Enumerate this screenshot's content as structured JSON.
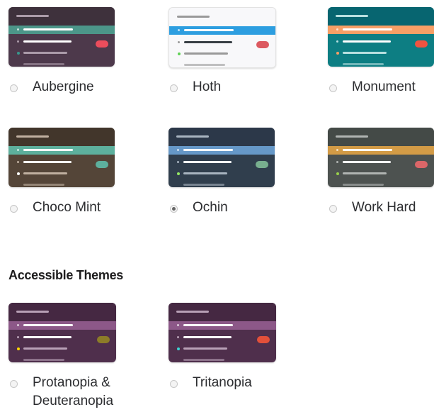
{
  "themes": [
    {
      "id": "aubergine",
      "label": "Aubergine",
      "selected": false,
      "colors": {
        "bg": "#4d394b",
        "top": "#3e313c",
        "active": "#4c9689",
        "activeText": "#ffffff",
        "text": "#ffffff",
        "dim": "#ab9ba9",
        "dot": "#38978d",
        "badge": "#eb4d5c"
      }
    },
    {
      "id": "hoth",
      "label": "Hoth",
      "selected": false,
      "colors": {
        "bg": "#f8f8fa",
        "top": "#f8f8fa",
        "active": "#2d9ee0",
        "activeText": "#ffffff",
        "text": "#383f45",
        "dim": "#999999",
        "dot": "#60d156",
        "badge": "#dc5960"
      }
    },
    {
      "id": "monument",
      "label": "Monument",
      "selected": false,
      "colors": {
        "bg": "#0d7e83",
        "top": "#076570",
        "active": "#f79f66",
        "activeText": "#ffffff",
        "text": "#ffffff",
        "dim": "#b8e0e0",
        "dot": "#f79f66",
        "badge": "#f15340"
      }
    },
    {
      "id": "choco-mint",
      "label": "Choco Mint",
      "selected": false,
      "colors": {
        "bg": "#544538",
        "top": "#42362b",
        "active": "#5db09d",
        "activeText": "#ffffff",
        "text": "#ffffff",
        "dim": "#c0b0a0",
        "dot": "#ffffff",
        "badge": "#5db09d"
      }
    },
    {
      "id": "ochin",
      "label": "Ochin",
      "selected": true,
      "colors": {
        "bg": "#303e4d",
        "top": "#2c3849",
        "active": "#6698c8",
        "activeText": "#ffffff",
        "text": "#ffffff",
        "dim": "#a8b4c0",
        "dot": "#94e864",
        "badge": "#78af8f"
      }
    },
    {
      "id": "work-hard",
      "label": "Work Hard",
      "selected": false,
      "colors": {
        "bg": "#4d5250",
        "top": "#444a47",
        "active": "#d39b46",
        "activeText": "#ffffff",
        "text": "#ffffff",
        "dim": "#b0b4b2",
        "dot": "#99d04a",
        "badge": "#db6668"
      }
    },
    {
      "id": "protanopia-deuteranopia",
      "label": "Protanopia &",
      "label2": "Deuteranopia",
      "selected": false,
      "colors": {
        "bg": "#4f2f4c",
        "top": "#452842",
        "active": "#8c5888",
        "activeText": "#ffffff",
        "text": "#ffffff",
        "dim": "#b8a0b6",
        "dot": "#ffd700",
        "badge": "#8c7c28"
      }
    },
    {
      "id": "tritanopia",
      "label": "Tritanopia",
      "selected": false,
      "colors": {
        "bg": "#4f2f4c",
        "top": "#452842",
        "active": "#8c5888",
        "activeText": "#ffffff",
        "text": "#ffffff",
        "dim": "#b8a0b6",
        "dot": "#3cd3d3",
        "badge": "#e2503a"
      }
    }
  ],
  "sections": {
    "accessible_title": "Accessible Themes"
  }
}
